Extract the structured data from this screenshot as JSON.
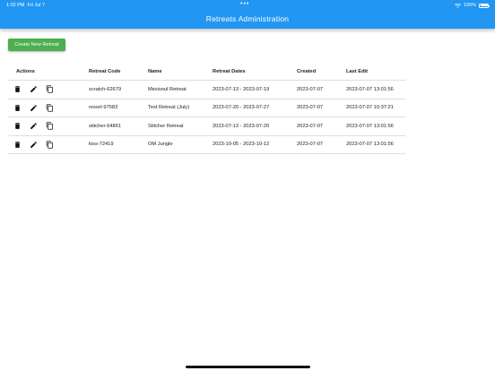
{
  "status_bar": {
    "time": "1:02 PM",
    "date": "Fri Jul 7",
    "battery": "100%"
  },
  "app_bar": {
    "title": "Retreats Administration"
  },
  "create_button": {
    "label": "Create New Retreat"
  },
  "table": {
    "headers": {
      "actions": "Actions",
      "code": "Retreat Code",
      "name": "Name",
      "dates": "Retreat Dates",
      "created": "Created",
      "last_edit": "Last Edit"
    },
    "rows": [
      {
        "code": "scratch-62679",
        "name": "Mexisoul Retreat",
        "dates": "2023-07-13 - 2023-07-19",
        "created": "2023-07-07",
        "last_edit": "2023-07-07 13:01:56"
      },
      {
        "code": "resort-97583",
        "name": "Test Retreat (July)",
        "dates": "2023-07-20 - 2023-07-27",
        "created": "2023-07-07",
        "last_edit": "2023-07-07 10:37:21"
      },
      {
        "code": "stitcher-64861",
        "name": "Stitcher Retreat",
        "dates": "2023-07-13 - 2023-07-20",
        "created": "2023-07-07",
        "last_edit": "2023-07-07 13:01:56"
      },
      {
        "code": "kiss-72419",
        "name": "OM Jungle",
        "dates": "2023-10-05 - 2023-10-12",
        "created": "2023-07-07",
        "last_edit": "2023-07-07 13:01:56"
      }
    ]
  },
  "icons": {
    "delete": "trash-icon",
    "edit": "pencil-icon",
    "copy": "copy-icon"
  },
  "colors": {
    "app_bar": "#2196f3",
    "create_button": "#4caf50"
  }
}
